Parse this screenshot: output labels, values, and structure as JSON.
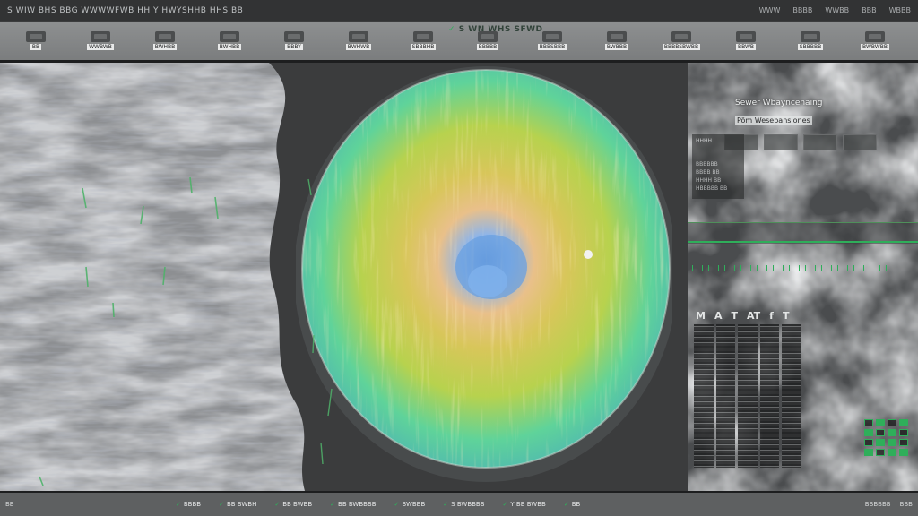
{
  "window": {
    "title": "S WIW  BHS BBG  WWWWFWB HH  Y  HWYSHHB  HHS  BB",
    "menu": [
      "WWW",
      "BBBB",
      "WWBB",
      "BBB",
      "WBBB"
    ]
  },
  "toolbar": {
    "centre_title": "S WN WHS SFWD",
    "tools": [
      {
        "label": "BB",
        "icon": "layers-icon"
      },
      {
        "label": "WWBWB",
        "icon": "map-icon"
      },
      {
        "label": "BWHBB",
        "icon": "grid-icon"
      },
      {
        "label": "BWHBB",
        "icon": "chart-icon"
      },
      {
        "label": "BBBY",
        "icon": "globe-icon"
      },
      {
        "label": "BWHWB",
        "icon": "radar-icon"
      },
      {
        "label": "SBBBHB",
        "icon": "wind-icon"
      },
      {
        "label": "BBBBB",
        "icon": "temperature-icon"
      },
      {
        "label": "BBBSBBB",
        "icon": "pressure-icon"
      },
      {
        "label": "BWBBB",
        "icon": "cloud-icon"
      },
      {
        "label": "BBBBSBWBB",
        "icon": "satellite-icon"
      },
      {
        "label": "BBWB",
        "icon": "settings-icon"
      },
      {
        "label": "SBBBBB",
        "icon": "export-icon"
      },
      {
        "label": "BWBWBB",
        "icon": "help-icon"
      }
    ]
  },
  "right_panel": {
    "title": "Sewer Wbayncenaing",
    "subtitle": "Pöm Wesebansiones",
    "stat_head": "HHHH",
    "stats": [
      "BBBBBB",
      "BBBB BB",
      "HHHH BB",
      "HBBBBB BB"
    ],
    "symbols": [
      "M",
      "A",
      "T",
      "AT",
      "f",
      "T"
    ],
    "indicators": [
      false,
      true,
      false,
      true,
      true,
      false,
      true,
      false,
      false,
      true,
      true,
      false,
      true,
      false,
      true,
      true
    ]
  },
  "statusbar": {
    "left": "BB",
    "items": [
      "BBBB",
      "BB BWBH",
      "BB BWBB",
      "BB BWBBBB",
      "BWBBB",
      "S BWBBBB",
      "Y BB BWBB",
      "BB"
    ],
    "right": [
      "BBBBBB",
      "BBB"
    ]
  },
  "colors": {
    "accent": "#2fae5a",
    "toolbar": "#8e9091",
    "background": "#2a2b2c"
  }
}
